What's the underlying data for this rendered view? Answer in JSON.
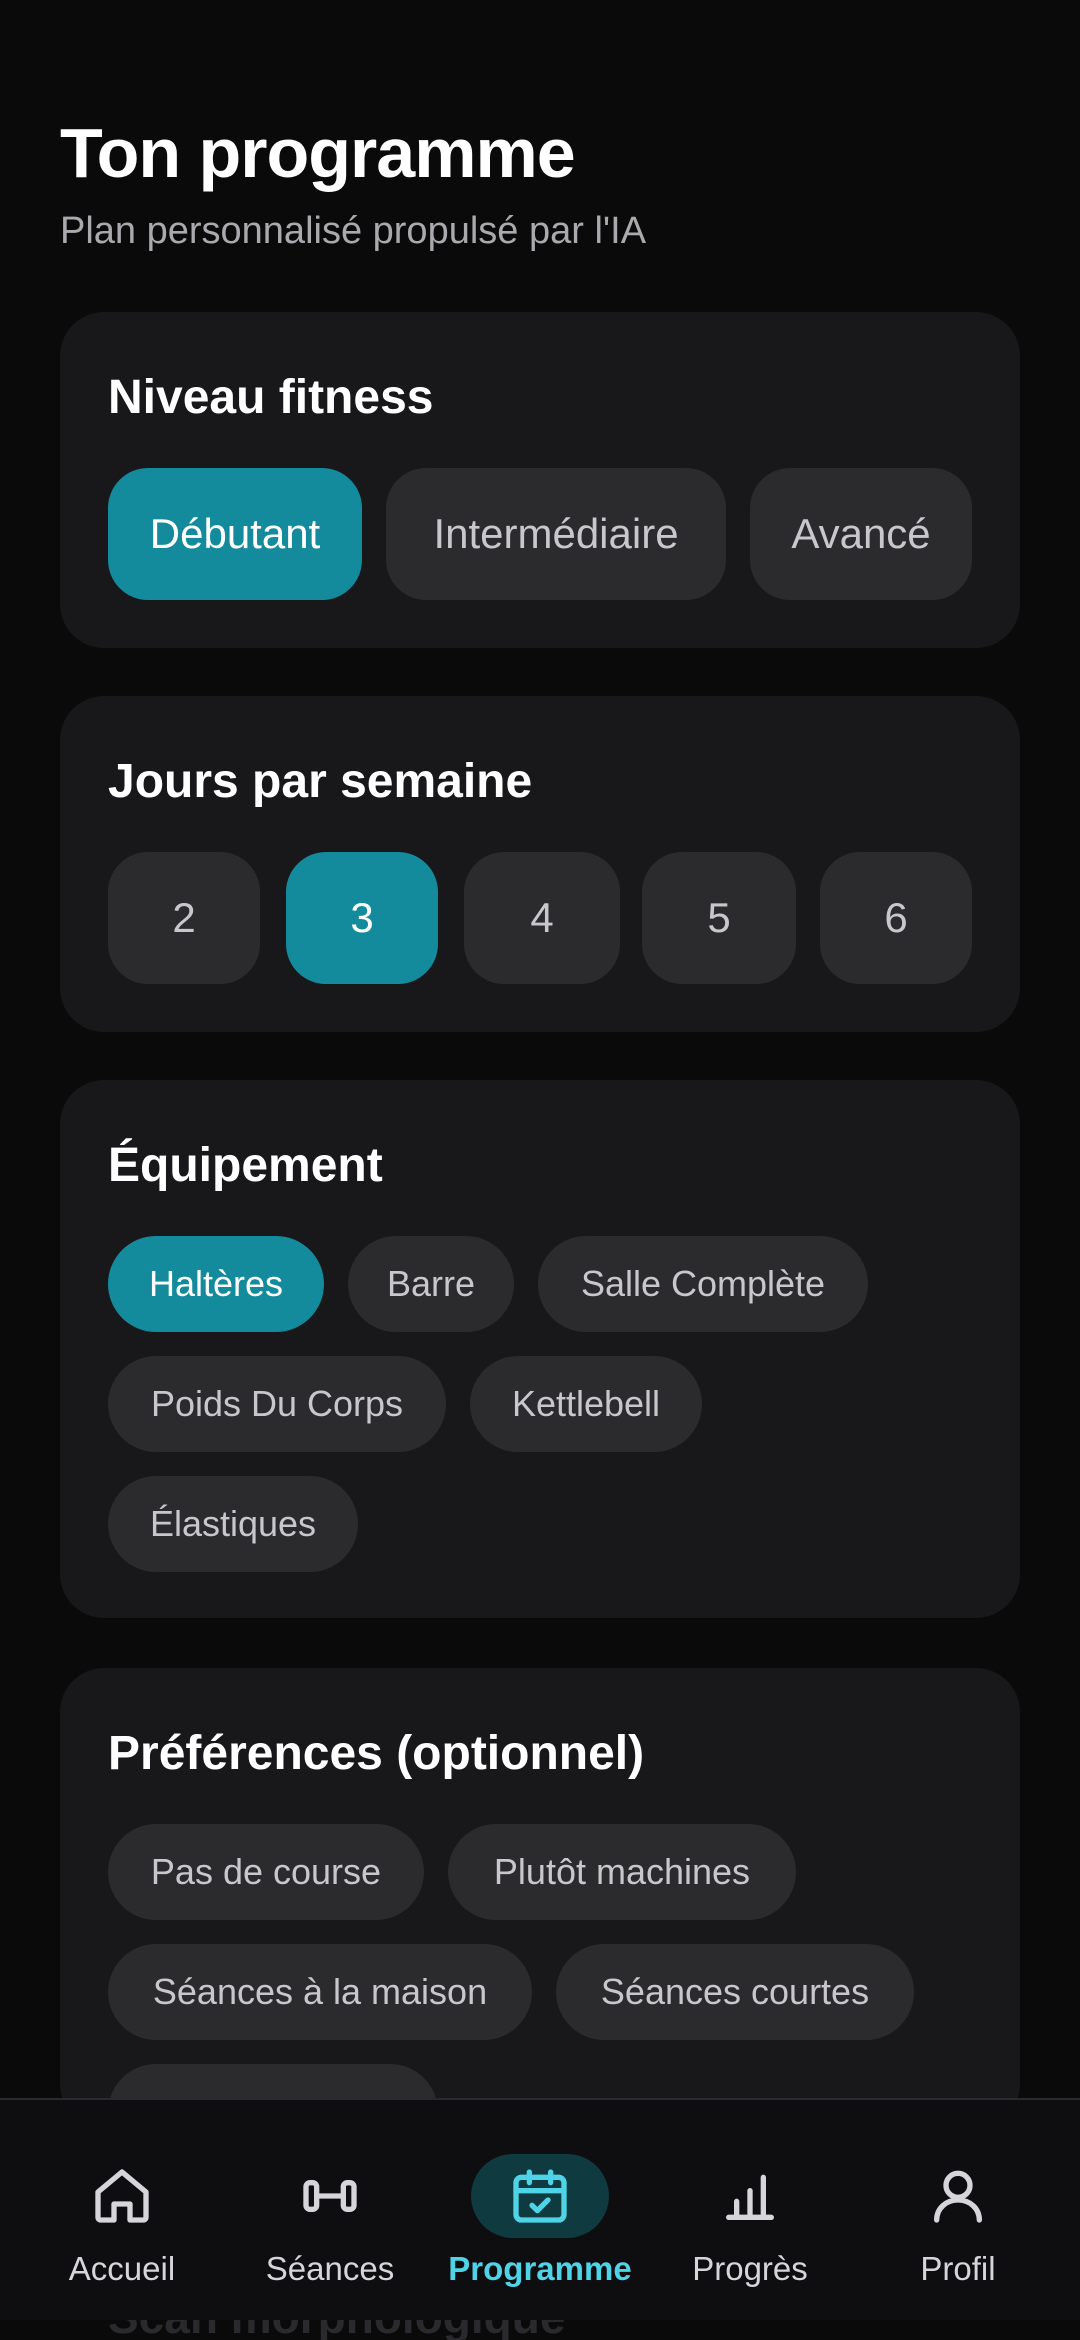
{
  "header": {
    "title": "Ton programme",
    "subtitle": "Plan personnalisé propulsé par l'IA"
  },
  "fitness": {
    "title": "Niveau fitness",
    "options": [
      "Débutant",
      "Intermédiaire",
      "Avancé"
    ],
    "selected": "Débutant"
  },
  "days": {
    "title": "Jours par semaine",
    "options": [
      "2",
      "3",
      "4",
      "5",
      "6"
    ],
    "selected": "3"
  },
  "equipment": {
    "title": "Équipement",
    "options": [
      "Haltères",
      "Barre",
      "Salle Complète",
      "Poids Du Corps",
      "Kettlebell",
      "Élastiques"
    ],
    "selected": [
      "Haltères"
    ]
  },
  "preferences": {
    "title": "Préférences (optionnel)",
    "options": [
      "Pas de course",
      "Plutôt machines",
      "Séances à la maison",
      "Séances courtes"
    ]
  },
  "next_section_peek": "Scan morphologique",
  "nav": {
    "items": [
      {
        "label": "Accueil",
        "icon": "home-icon"
      },
      {
        "label": "Séances",
        "icon": "dumbbell-icon"
      },
      {
        "label": "Programme",
        "icon": "calendar-check-icon"
      },
      {
        "label": "Progrès",
        "icon": "bar-chart-icon"
      },
      {
        "label": "Profil",
        "icon": "user-icon"
      }
    ],
    "active": "Programme"
  },
  "colors": {
    "accent": "#148b9c",
    "accent_text": "#4fd3e6",
    "background": "#0a0a0a",
    "card": "#18181b",
    "chip": "#2b2b2e"
  }
}
